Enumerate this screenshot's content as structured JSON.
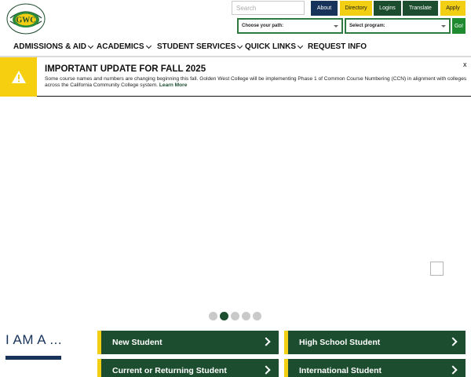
{
  "header": {
    "logo_text": "GWC",
    "logo_ring_text": "GOLDEN WEST COLLEGE",
    "search_placeholder": "Search",
    "buttons": {
      "about": "About",
      "directory": "Directory",
      "logins": "Logins",
      "translate": "Translate",
      "apply": "Apply"
    },
    "path_select": "Choose your path:",
    "program_select": "Select program:",
    "go_label": "Go!"
  },
  "nav": {
    "items": [
      {
        "label": "ADMISSIONS & AID"
      },
      {
        "label": "ACADEMICS"
      },
      {
        "label": "STUDENT SERVICES"
      },
      {
        "label": "QUICK LINKS"
      },
      {
        "label": "REQUEST INFO"
      }
    ]
  },
  "alert": {
    "title": "IMPORTANT UPDATE FOR FALL 2025",
    "text": "Some course names and numbers are changing beginning this fall. Golden West College will be implementing Phase 1 of Common Course Numbering (CCN) in alignment with colleges across the California Community College system.",
    "link": "Learn More",
    "close": "x"
  },
  "carousel": {
    "slide_count": 5,
    "active_slide": 2
  },
  "iam": {
    "heading": "I AM A ...",
    "options": [
      {
        "label": "New Student"
      },
      {
        "label": "High School Student"
      },
      {
        "label": "Current or Returning Student"
      },
      {
        "label": "International Student"
      }
    ]
  },
  "colors": {
    "navy": "#18335a",
    "green": "#1c4d2e",
    "gold": "#f2cf12",
    "go_green": "#1f8a2f"
  }
}
